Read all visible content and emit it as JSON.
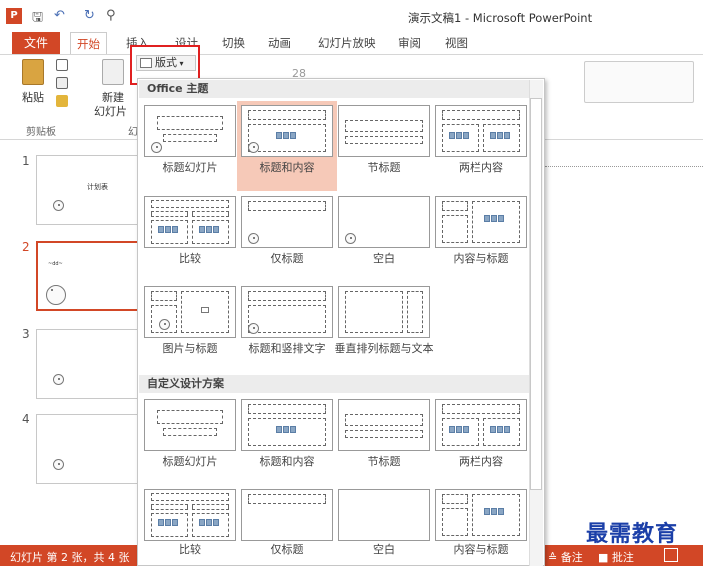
{
  "titlebar": {
    "app_icon": "P",
    "qa_save": "🖫",
    "qa_undo": "↶",
    "qa_redo": "↻",
    "qa_customize": "⚲",
    "doc_title": "演示文稿1 - Microsoft PowerPoint"
  },
  "tabs": {
    "file": "文件",
    "items": [
      "开始",
      "插入",
      "设计",
      "切换",
      "动画",
      "幻灯片放映",
      "审阅",
      "视图"
    ]
  },
  "ribbon": {
    "paste": "粘贴",
    "new_slide_line1": "新建",
    "new_slide_line2": "幻灯片",
    "clipboard_group": "剪贴板",
    "slides_group_short": "幻",
    "layout_button": "版式",
    "font_size": "28"
  },
  "slides": {
    "numbers": [
      "1",
      "2",
      "3",
      "4"
    ],
    "slide1_text": "计划表",
    "slide2_text": "~dd~"
  },
  "dropdown": {
    "section_office": "Office 主题",
    "section_custom": "自定义设计方案",
    "office_layouts": [
      "标题幻灯片",
      "标题和内容",
      "节标题",
      "两栏内容",
      "比较",
      "仅标题",
      "空白",
      "内容与标题",
      "图片与标题",
      "标题和竖排文字",
      "垂直排列标题与文本"
    ],
    "custom_layouts": [
      "标题幻灯片",
      "标题和内容",
      "节标题",
      "两栏内容",
      "比较",
      "仅标题",
      "空白",
      "内容与标题"
    ]
  },
  "statusbar": {
    "slide_info": "幻灯片 第 2 张，共 4 张",
    "notes": "≙ 备注",
    "comments": "■ 批注"
  },
  "watermark": "最需教育",
  "colors": {
    "accent": "#d24726",
    "highlight_border": "#e02020",
    "selected_cell": "#f6c9b8"
  }
}
